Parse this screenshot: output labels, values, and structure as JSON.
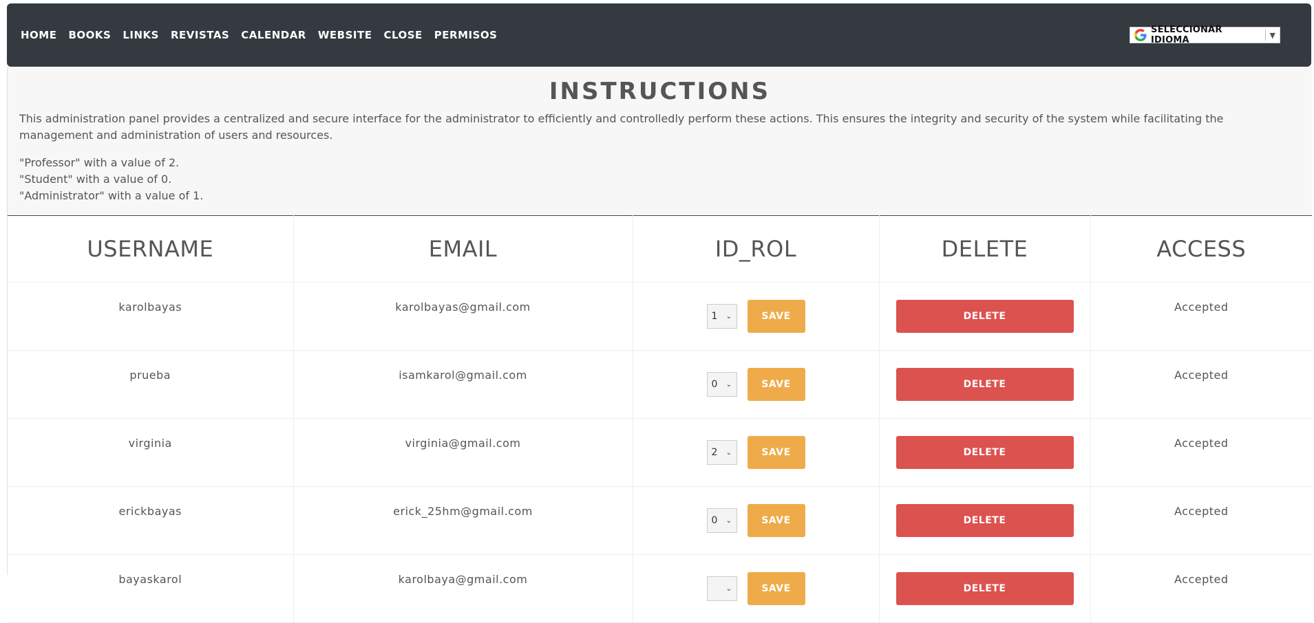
{
  "nav": {
    "links": [
      "HOME",
      "BOOKS",
      "LINKS",
      "REVISTAS",
      "CALENDAR",
      "WEBSITE",
      "CLOSE",
      "PERMISOS"
    ],
    "translate": {
      "label": "SELECCIONAR IDIOMA",
      "arrow": "▼",
      "icon": "google-icon"
    }
  },
  "instructions": {
    "title": "INSTRUCTIONS",
    "text": "This administration panel provides a centralized and secure interface for the administrator to efficiently and controlledly perform these actions. This ensures the integrity and security of the system while facilitating the management and administration of users and resources.",
    "roles": [
      "\"Professor\" with a value of 2.",
      "\"Student\" with a value of 0.",
      "\"Administrator\" with a value of 1."
    ]
  },
  "table": {
    "headers": [
      "USERNAME",
      "EMAIL",
      "ID_ROL",
      "DELETE",
      "ACCESS"
    ],
    "save_label": "SAVE",
    "delete_label": "DELETE",
    "rows": [
      {
        "username": "karolbayas",
        "email": "karolbayas@gmail.com",
        "id_rol": "1",
        "access": "Accepted"
      },
      {
        "username": "prueba",
        "email": "isamkarol@gmail.com",
        "id_rol": "0",
        "access": "Accepted"
      },
      {
        "username": "virginia",
        "email": "virginia@gmail.com",
        "id_rol": "2",
        "access": "Accepted"
      },
      {
        "username": "erickbayas",
        "email": "erick_25hm@gmail.com",
        "id_rol": "0",
        "access": "Accepted"
      },
      {
        "username": "bayaskarol",
        "email": "karolbaya@gmail.com",
        "id_rol": "",
        "access": "Accepted"
      }
    ]
  },
  "colors": {
    "navbar": "#343a40",
    "save": "#efab49",
    "delete": "#dc524f",
    "instructions_bg": "#f7f7f7"
  }
}
